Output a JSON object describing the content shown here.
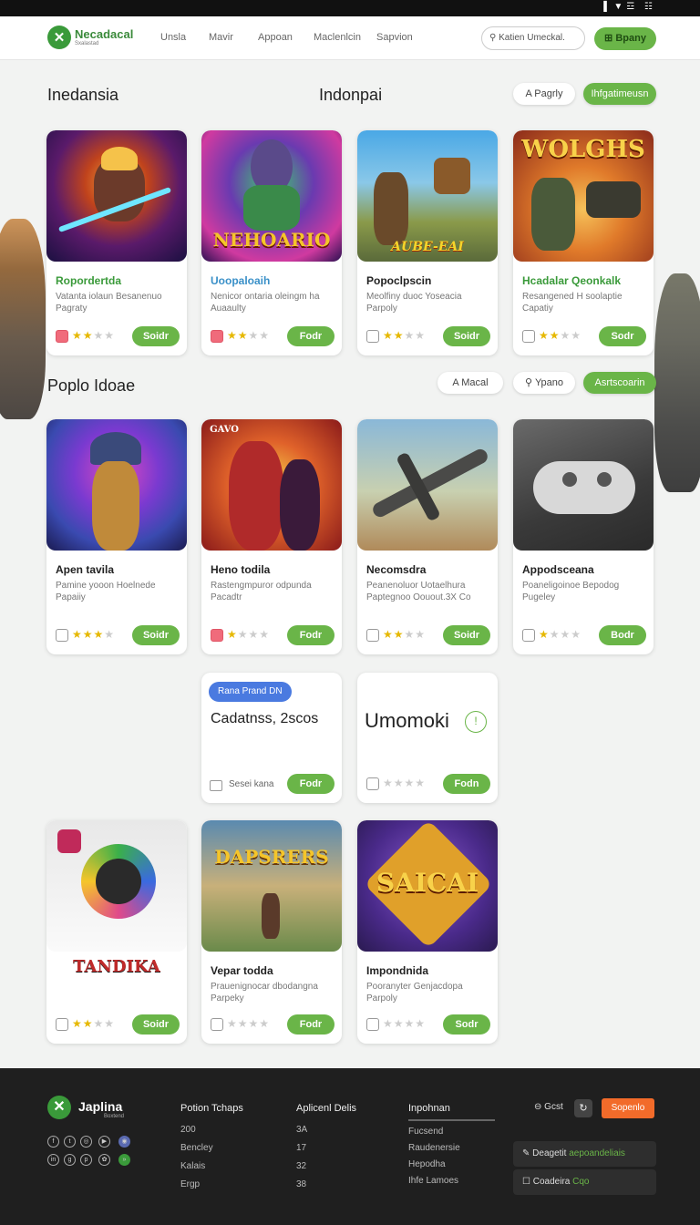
{
  "status": {
    "icons": "▌▼☲ ☷"
  },
  "nav": {
    "brand": "Necadacal",
    "tagline": "Sxalastad",
    "links": [
      "Unsla",
      "Mavir",
      "Appoan",
      "Maclenlcin",
      "Sapvion"
    ],
    "search_placeholder": "Katien Umeckal.",
    "cta": "Bpany"
  },
  "sections": {
    "s1_title_left": "Inedansia",
    "s1_title_center": "Indonpai",
    "s1_filter_1": "Pagrly",
    "s1_filter_2": "Ihfgatimeusn",
    "s2_title": "Poplo Idoae",
    "s2_filter_1": "Macal",
    "s2_filter_2": "Ypano",
    "s2_filter_3": "Asrtscoarin"
  },
  "colors": {
    "accent": "#6ab548",
    "footer_bg": "#1f1f1f",
    "orange": "#f26b2a"
  },
  "cards": [
    {
      "title": "Ropordertda",
      "title_color": "#3a9a3a",
      "desc": "Vatanta iolaun Besanenuo Pagraty",
      "rating": 2,
      "badge": "red",
      "button": "Soidr",
      "art": "w1"
    },
    {
      "title": "Uoopaloaih",
      "title_color": "#3a90c8",
      "desc": "Nenicor ontaria oleingm ha Auaaulty",
      "rating": 2,
      "badge": "red",
      "button": "Fodr",
      "art": "w2",
      "art_text": "NEHOARIO"
    },
    {
      "title": "Popoclpscin",
      "title_color": "#222",
      "desc": "Meolfiny duoc Yoseacia Parpoly",
      "rating": 2,
      "badge": "plain",
      "button": "Soidr",
      "art": "w3",
      "art_text": "AUBE-EAI"
    },
    {
      "title": "Hcadalar Qeonkalk",
      "title_color": "#3a9a3a",
      "desc": "Resangened H soolaptie Capatiy",
      "rating": 2,
      "badge": "plain",
      "button": "Sodr",
      "art": "w4",
      "art_text": "WOLGHS"
    },
    {
      "title": "Apen tavila",
      "title_color": "#222",
      "desc": "Pamine yooon Hoelnede Papaiiy",
      "rating": 3,
      "badge": "plain",
      "button": "Soidr",
      "art": "w5"
    },
    {
      "title": "Heno todila",
      "title_color": "#222",
      "desc": "Rastengmpuror odpunda Pacadtr",
      "rating": 1,
      "badge": "red",
      "button": "Fodr",
      "art": "w6",
      "art_text": "GAVO"
    },
    {
      "title": "Necomsdra",
      "title_color": "#222",
      "desc": "Peanenoluor Uotaelhura Paptegnoo Oouout.3X Co",
      "rating": 2,
      "badge": "plain",
      "button": "Soidr",
      "art": "w7"
    },
    {
      "title": "Appodsceana",
      "title_color": "#222",
      "desc": "Poaneligoinoe Bepodog Pugeley",
      "rating": 1,
      "badge": "plain",
      "button": "Bodr",
      "art": "w8"
    },
    {
      "title": "Vepar todda",
      "title_color": "#222",
      "desc": "Prauenignocar dbodangna Parpeky",
      "rating": 0,
      "badge": "plain",
      "button": "Fodr",
      "art": "w10",
      "art_text": "DAPSRERS"
    },
    {
      "title": "Impondnida",
      "title_color": "#222",
      "desc": "Pooranyter Genjacdopa Parpoly",
      "rating": 0,
      "badge": "plain",
      "button": "Sodr",
      "art": "w11",
      "art_text": "SAICAI"
    },
    {
      "title": "",
      "title_color": "#222",
      "desc": "",
      "rating": 2,
      "badge": "plain",
      "button": "Soidr",
      "art": "w9",
      "art_text": "TANDIKA"
    }
  ],
  "promo": {
    "badge": "Rana Prand DN",
    "heading": "Cadatnss, 2scos",
    "footnote": "Sesei kana",
    "button": "Fodr",
    "title2": "Umomoki",
    "button2": "Fodn"
  },
  "footer": {
    "brand": "Japlina",
    "tagline": "Boxtend",
    "col1_title": "Potion Tchaps",
    "col1_items": [
      "200",
      "Bencley",
      "Kalais",
      "Ergp"
    ],
    "col2_title": "Aplicenl Delis",
    "col2_items": [
      "3A",
      "17",
      "32",
      "38"
    ],
    "col3_title": "Inpohnan",
    "col3_items": [
      "Fucsend",
      "Raudenersie",
      "Hepodha",
      "Ihfe Lamoes"
    ],
    "lang": "Gcst",
    "orange_btn": "Sopenlo",
    "box1_label": "Deagetit",
    "box1_accent": "aepoandeliais",
    "box2_label": "Coadeira",
    "box2_accent": "Cqo"
  }
}
